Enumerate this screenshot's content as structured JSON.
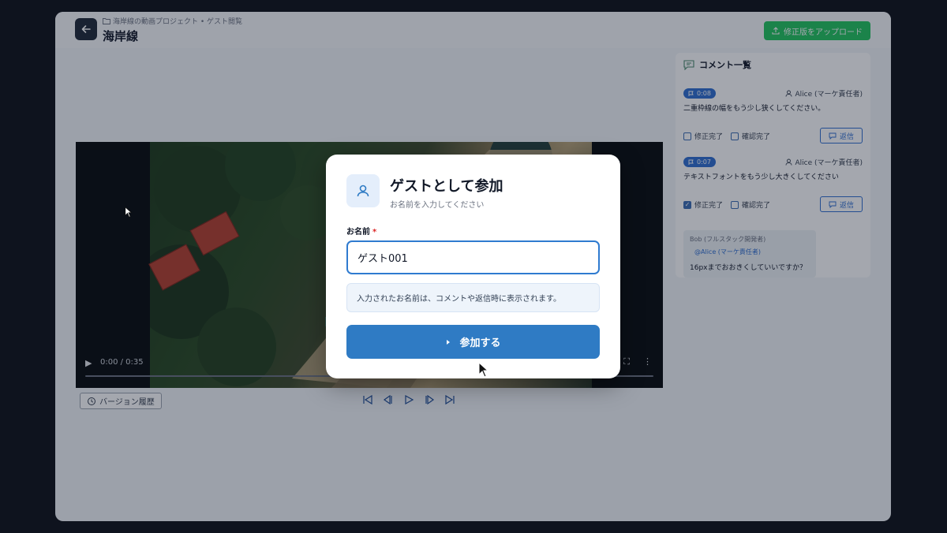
{
  "header": {
    "breadcrumb": "海岸線の動画プロジェクト • ゲスト閲覧",
    "title": "海岸線",
    "upload_label": "修正版をアップロード"
  },
  "video": {
    "time": "0:00 / 0:35"
  },
  "toolbar": {
    "version_history_label": "バージョン履歴"
  },
  "comments": {
    "heading": "コメント一覧",
    "items": [
      {
        "timestamp": "0:08",
        "author": "Alice (マーケ責任者)",
        "text": "二重枠線の幅をもう少し狭くしてください。",
        "fixed_label": "修正完了",
        "fixed": false,
        "confirmed_label": "確認完了",
        "confirmed": false,
        "reply_label": "返信"
      },
      {
        "timestamp": "0:07",
        "author": "Alice (マーケ責任者)",
        "text": "テキストフォントをもう少し大きくしてください",
        "fixed_label": "修正完了",
        "fixed": true,
        "confirmed_label": "確認完了",
        "confirmed": false,
        "reply_label": "返信"
      }
    ],
    "reply": {
      "author": "Bob (フルスタック開発者)",
      "mention": "@Alice (マーケ責任者)",
      "text": "16pxまでおおきくしていいですか？"
    }
  },
  "modal": {
    "title": "ゲストとして参加",
    "subtitle": "お名前を入力してください",
    "field_label": "お名前",
    "required_mark": "*",
    "name_value": "ゲスト001",
    "note": "入力されたお名前は、コメントや返信時に表示されます。",
    "join_label": "参加する"
  },
  "colors": {
    "accent": "#2f7bc4",
    "upload": "#22c55e",
    "badge": "#2f6fd0"
  }
}
